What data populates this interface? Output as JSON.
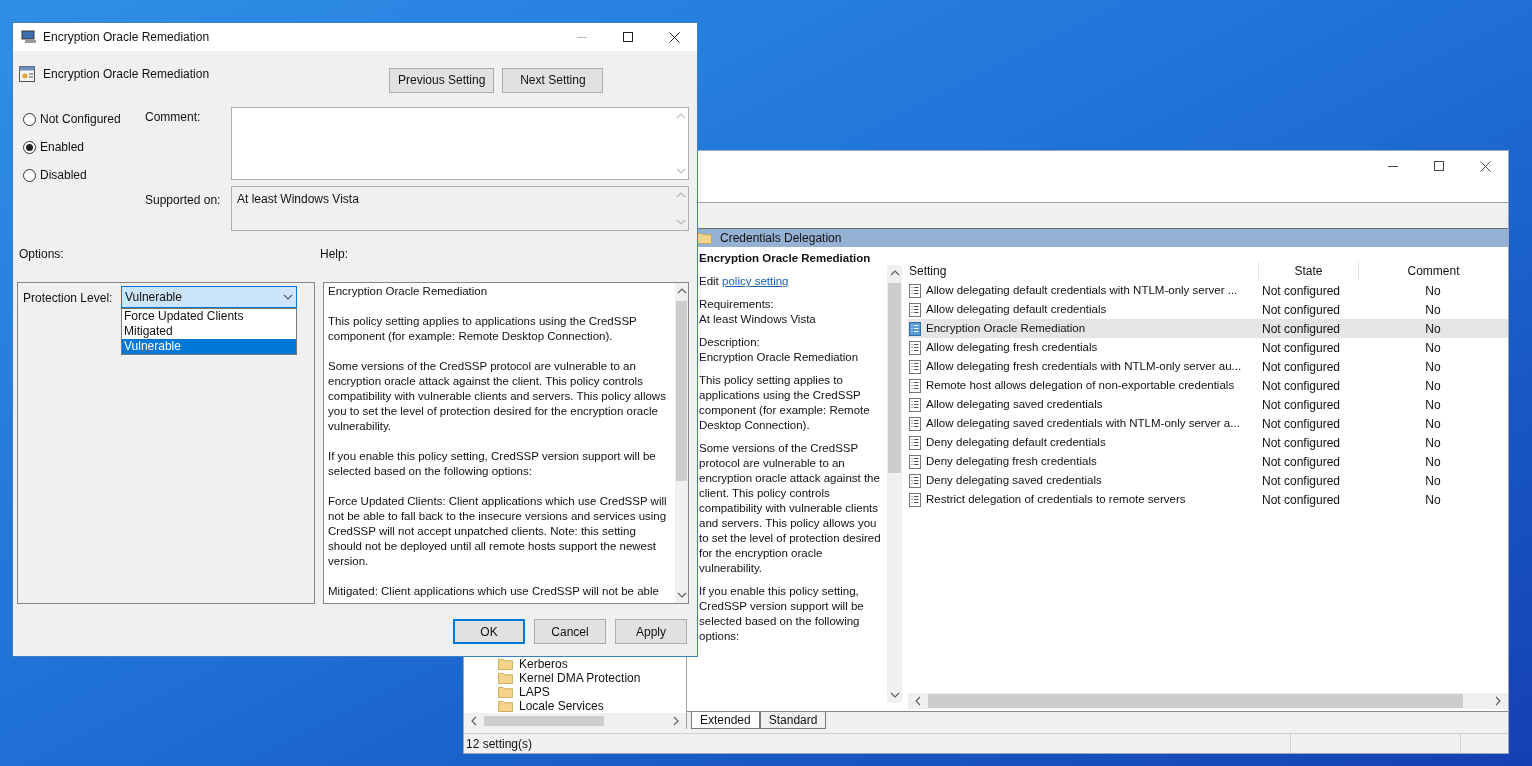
{
  "dialog": {
    "title": "Encryption Oracle Remediation",
    "heading": "Encryption Oracle Remediation",
    "nav_buttons": [
      "Previous Setting",
      "Next Setting"
    ],
    "radios": [
      {
        "label": "Not Configured",
        "selected": false
      },
      {
        "label": "Enabled",
        "selected": true
      },
      {
        "label": "Disabled",
        "selected": false
      }
    ],
    "comment": {
      "label": "Comment:"
    },
    "supported_on": {
      "label": "Supported on:",
      "value": "At least Windows Vista"
    },
    "options": {
      "label": "Options:",
      "field_label": "Protection Level:",
      "value": "Vulnerable",
      "expanded": true,
      "choices": [
        {
          "label": "Force Updated Clients",
          "selected": false
        },
        {
          "label": "Mitigated",
          "selected": false
        },
        {
          "label": "Vulnerable",
          "selected": true
        }
      ]
    },
    "help": {
      "label": "Help:",
      "paragraphs": [
        "Encryption Oracle Remediation",
        "This policy setting applies to applications using the CredSSP component (for example: Remote Desktop Connection).",
        "Some versions of the CredSSP protocol are vulnerable to an encryption oracle attack against the client.  This policy controls compatibility with vulnerable clients and servers.  This policy allows you to set the level of protection desired for the encryption oracle vulnerability.",
        "If you enable this policy setting, CredSSP version support will be selected based on the following options:",
        "Force Updated Clients: Client applications which use CredSSP will not be able to fall back to the insecure versions and services using CredSSP will not accept unpatched clients. Note: this setting should not be deployed until all remote hosts support the newest version.",
        "Mitigated: Client applications which use CredSSP will not be able"
      ]
    },
    "buttons": [
      {
        "label": "OK",
        "default": true
      },
      {
        "label": "Cancel",
        "default": false
      },
      {
        "label": "Apply",
        "default": false
      }
    ]
  },
  "editor": {
    "tree": [
      "Kerberos",
      "Kernel DMA Protection",
      "LAPS",
      "Locale Services"
    ],
    "breadcrumb": "Credentials Delegation",
    "extended": {
      "title": "Encryption Oracle Remediation",
      "edit_prefix": "Edit",
      "edit_link": "policy setting",
      "requirements_label": "Requirements:",
      "requirements": "At least Windows Vista",
      "description_label": "Description:",
      "description": "Encryption Oracle Remediation",
      "paragraphs": [
        "This policy setting applies to applications using the CredSSP component (for example: Remote Desktop Connection).",
        "Some versions of the CredSSP protocol are vulnerable to an encryption oracle attack against the client.  This policy controls compatibility with vulnerable clients and servers.  This policy allows you to set the level of protection desired for the encryption oracle vulnerability.",
        "If you enable this policy setting, CredSSP version support will be selected based on the following options:"
      ]
    },
    "table": {
      "columns": [
        "Setting",
        "State",
        "Comment"
      ],
      "rows": [
        {
          "setting": "Allow delegating default credentials with NTLM-only server ...",
          "state": "Not configured",
          "comment": "No",
          "selected": false
        },
        {
          "setting": "Allow delegating default credentials",
          "state": "Not configured",
          "comment": "No",
          "selected": false
        },
        {
          "setting": "Encryption Oracle Remediation",
          "state": "Not configured",
          "comment": "No",
          "selected": true
        },
        {
          "setting": "Allow delegating fresh credentials",
          "state": "Not configured",
          "comment": "No",
          "selected": false
        },
        {
          "setting": "Allow delegating fresh credentials with NTLM-only server au...",
          "state": "Not configured",
          "comment": "No",
          "selected": false
        },
        {
          "setting": "Remote host allows delegation of non-exportable credentials",
          "state": "Not configured",
          "comment": "No",
          "selected": false
        },
        {
          "setting": "Allow delegating saved credentials",
          "state": "Not configured",
          "comment": "No",
          "selected": false
        },
        {
          "setting": "Allow delegating saved credentials with NTLM-only server a...",
          "state": "Not configured",
          "comment": "No",
          "selected": false
        },
        {
          "setting": "Deny delegating default credentials",
          "state": "Not configured",
          "comment": "No",
          "selected": false
        },
        {
          "setting": "Deny delegating fresh credentials",
          "state": "Not configured",
          "comment": "No",
          "selected": false
        },
        {
          "setting": "Deny delegating saved credentials",
          "state": "Not configured",
          "comment": "No",
          "selected": false
        },
        {
          "setting": "Restrict delegation of credentials to remote servers",
          "state": "Not configured",
          "comment": "No",
          "selected": false
        }
      ]
    },
    "tabs": [
      {
        "label": "Extended",
        "selected": true
      },
      {
        "label": "Standard",
        "selected": false
      }
    ],
    "status_bar": "12 setting(s)"
  }
}
